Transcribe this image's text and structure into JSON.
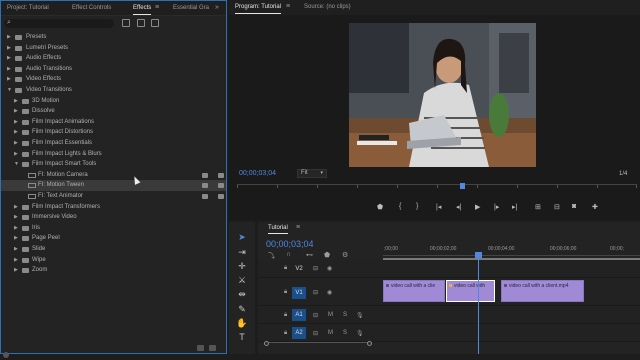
{
  "effects_panel": {
    "tabs": [
      {
        "label": "Project: Tutorial",
        "active": false
      },
      {
        "label": "Effect Controls",
        "active": false
      },
      {
        "label": "Effects",
        "active": true
      },
      {
        "label": "Essential Gra",
        "active": false
      }
    ],
    "search_placeholder": "",
    "items": [
      {
        "label": "Presets",
        "level": 0,
        "expanded": false
      },
      {
        "label": "Lumetri Presets",
        "level": 0,
        "expanded": false
      },
      {
        "label": "Audio Effects",
        "level": 0,
        "expanded": false
      },
      {
        "label": "Audio Transitions",
        "level": 0,
        "expanded": false
      },
      {
        "label": "Video Effects",
        "level": 0,
        "expanded": false
      },
      {
        "label": "Video Transitions",
        "level": 0,
        "expanded": true
      },
      {
        "label": "3D Motion",
        "level": 1,
        "expanded": false
      },
      {
        "label": "Dissolve",
        "level": 1,
        "expanded": false
      },
      {
        "label": "Film Impact Animations",
        "level": 1,
        "expanded": false
      },
      {
        "label": "Film Impact Distortions",
        "level": 1,
        "expanded": false
      },
      {
        "label": "Film Impact Essentials",
        "level": 1,
        "expanded": false
      },
      {
        "label": "Film Impact Lights & Blurs",
        "level": 1,
        "expanded": false
      },
      {
        "label": "Film Impact Smart Tools",
        "level": 1,
        "expanded": true
      },
      {
        "label": "FI: Motion Camera",
        "level": 2,
        "effect": true
      },
      {
        "label": "FI: Motion Tween",
        "level": 2,
        "effect": true,
        "selected": true
      },
      {
        "label": "FI: Text Animator",
        "level": 2,
        "effect": true
      },
      {
        "label": "Film Impact Transformers",
        "level": 1,
        "expanded": false
      },
      {
        "label": "Immersive Video",
        "level": 1,
        "expanded": false
      },
      {
        "label": "Iris",
        "level": 1,
        "expanded": false
      },
      {
        "label": "Page Peel",
        "level": 1,
        "expanded": false
      },
      {
        "label": "Slide",
        "level": 1,
        "expanded": false
      },
      {
        "label": "Wipe",
        "level": 1,
        "expanded": false
      },
      {
        "label": "Zoom",
        "level": 1,
        "expanded": false
      }
    ]
  },
  "program_monitor": {
    "tab_active": "Program: Tutorial",
    "tab_source": "Source: (no clips)",
    "timecode": "00;00;03;04",
    "fit": "Fit",
    "fraction": "1/4",
    "transport": [
      "marker-icon",
      "in-point-icon",
      "out-point-icon",
      "go-to-in-icon",
      "step-back-icon",
      "play-icon",
      "step-forward-icon",
      "go-to-out-icon",
      "insert-icon",
      "overwrite-icon",
      "export-frame-icon",
      "button-editor-icon"
    ]
  },
  "timeline": {
    "tab": "Tutorial",
    "timecode": "00;00;03;04",
    "ruler": [
      ";00;00",
      "00;00;02;00",
      "00;00;04;00",
      "00;00;06;00",
      "00;00;"
    ],
    "tracks": [
      {
        "name": "V2",
        "type": "video"
      },
      {
        "name": "V1",
        "type": "video",
        "target": true
      },
      {
        "name": "A1",
        "type": "audio",
        "target": true
      },
      {
        "name": "A2",
        "type": "audio",
        "target": true
      }
    ],
    "clips": [
      {
        "label": "video call with a clie"
      },
      {
        "label": "video call with"
      },
      {
        "label": "video call with a client.mp4"
      }
    ]
  },
  "colors": {
    "accent": "#4f8ae0",
    "clip": "#a08ad6",
    "panel_border": "#2f6fb6"
  }
}
